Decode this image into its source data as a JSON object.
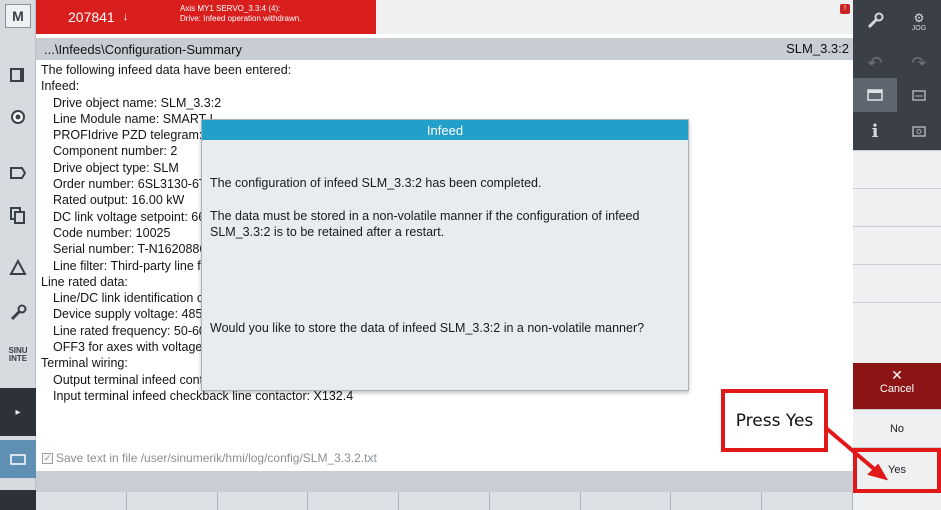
{
  "left_toolbar": {
    "top_logo": "M",
    "icons": [
      "machine-icon",
      "program-icon",
      "tool-icon",
      "document-icon",
      "copy-icon",
      "measure-icon",
      "wrench-icon",
      "sinumerik-integrate-icon",
      "arrow-right-icon",
      "screen-icon"
    ],
    "sinumerik_label": "SINU\nINTE"
  },
  "alarm": {
    "number": "207841",
    "flag": "↓",
    "line1": "Axis MY1 SERVO_3.3:4 (4):",
    "line2": "Drive: Infeed operation withdrawn."
  },
  "header": {
    "path": "...\\Infeeds\\Configuration-Summary",
    "object": "SLM_3.3:2"
  },
  "content": {
    "lines": [
      {
        "level": 0,
        "text": "The following infeed data have been entered:"
      },
      {
        "level": 0,
        "text": "Infeed:"
      },
      {
        "level": 1,
        "text": "Drive object name: SLM_3.3:2"
      },
      {
        "level": 1,
        "text": "Line Module name: SMART I"
      },
      {
        "level": 1,
        "text": "PROFIdrive PZD telegram: F"
      },
      {
        "level": 1,
        "text": "Component number: 2"
      },
      {
        "level": 1,
        "text": "Drive object type: SLM"
      },
      {
        "level": 1,
        "text": "Order number: 6SL3130-6T"
      },
      {
        "level": 1,
        "text": "Rated output: 16.00 kW"
      },
      {
        "level": 1,
        "text": "DC link voltage setpoint: 66"
      },
      {
        "level": 1,
        "text": "Code number: 10025"
      },
      {
        "level": 1,
        "text": "Serial number: T-N1620886"
      },
      {
        "level": 1,
        "text": "Line filter: Third-party line f"
      },
      {
        "level": 0,
        "text": "Line rated data:"
      },
      {
        "level": 1,
        "text": "Line/DC link identification o"
      },
      {
        "level": 1,
        "text": "Device supply voltage: 485.("
      },
      {
        "level": 1,
        "text": "Line rated frequency: 50-60"
      },
      {
        "level": 1,
        "text": "OFF3 for axes with voltage c"
      },
      {
        "level": 0,
        "text": "Terminal wiring:"
      },
      {
        "level": 1,
        "text": "Output terminal infeed control line contactor: X132.12"
      },
      {
        "level": 1,
        "text": "Input terminal infeed checkback line contactor: X132.4"
      }
    ]
  },
  "dialog": {
    "title": "Infeed",
    "message1": "The configuration of infeed SLM_3.3:2 has been completed.",
    "message2": "The data must be stored in a non-volatile manner if the configuration of infeed SLM_3.3:2 is to be retained after a restart.",
    "question": "Would you like to store the data of infeed SLM_3.3:2 in a non-volatile manner?"
  },
  "save_option": {
    "checked": true,
    "label": "Save text in file /user/sinumerik/hmi/log/config/SLM_3.3.2.txt"
  },
  "right_panel": {
    "top_icons": [
      "wrench-icon",
      "jog-icon",
      "undo-icon",
      "redo-icon",
      "window-icon",
      "keyboard-icon",
      "info-icon",
      "camera-icon"
    ],
    "jog_label": "JOG"
  },
  "softkeys": {
    "cancel_symbol": "✕",
    "cancel_label": "Cancel",
    "no_label": "No",
    "yes_label": "Yes"
  },
  "annotation": {
    "callout_text": "Press Yes",
    "color": "#e01818"
  }
}
